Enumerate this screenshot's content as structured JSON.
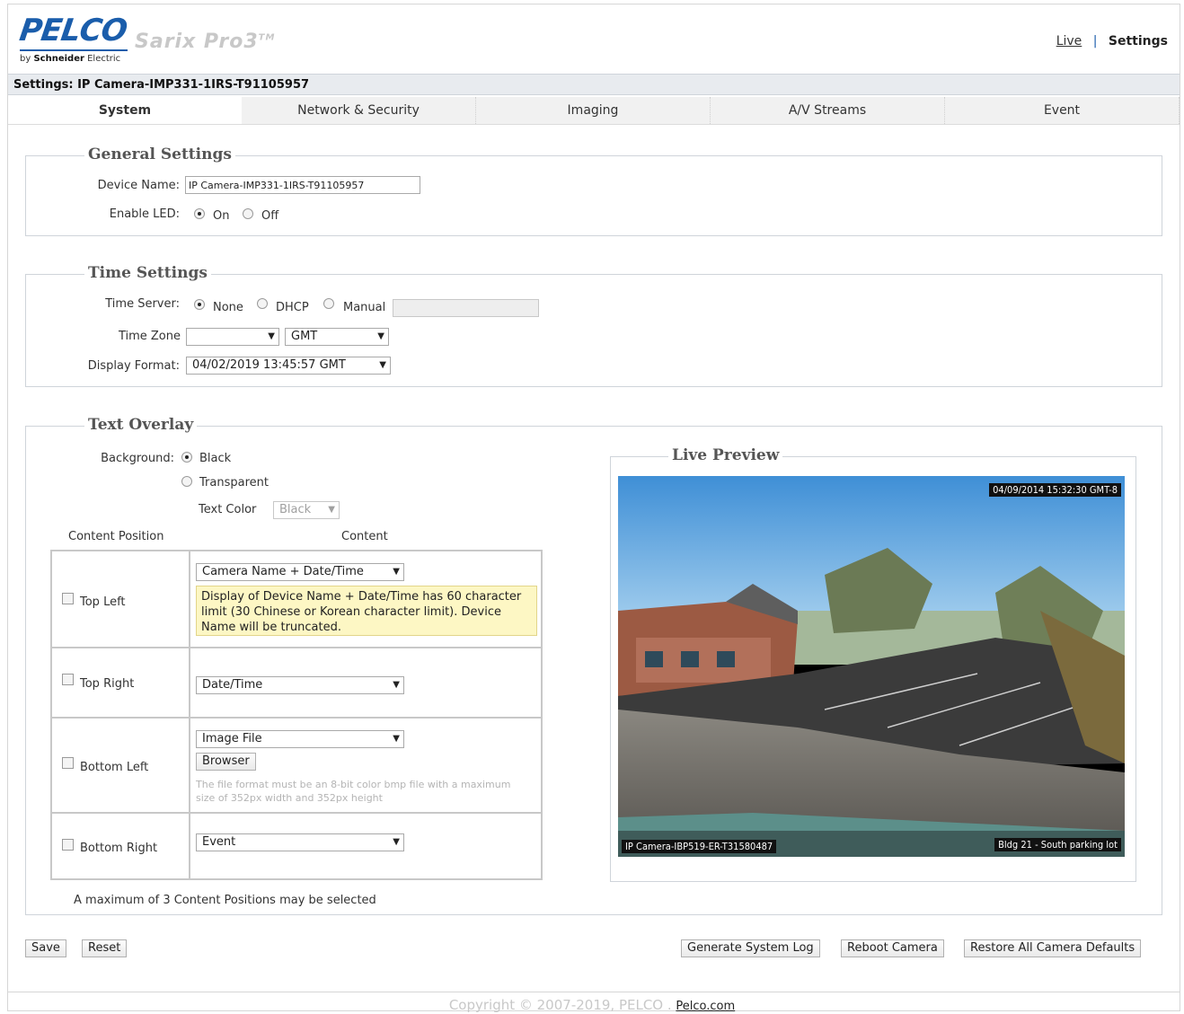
{
  "header": {
    "logo": "PELCO",
    "logo_sub_prefix": "by",
    "logo_sub_brand": "Schneider",
    "logo_sub_suffix": "Electric",
    "product": "Sarix Pro3",
    "product_tm": "TM",
    "nav_live": "Live",
    "nav_separator": "|",
    "nav_settings": "Settings"
  },
  "title_bar": "Settings: IP Camera-IMP331-1IRS-T91105957",
  "tabs": [
    "System",
    "Network & Security",
    "Imaging",
    "A/V Streams",
    "Event"
  ],
  "general": {
    "legend": "General Settings",
    "device_name_label": "Device Name:",
    "device_name_value": "IP Camera-IMP331-1IRS-T91105957",
    "enable_led_label": "Enable LED:",
    "led_on": "On",
    "led_off": "Off"
  },
  "time": {
    "legend": "Time Settings",
    "server_label": "Time Server:",
    "server_none": "None",
    "server_dhcp": "DHCP",
    "server_manual": "Manual",
    "zone_label": "Time Zone",
    "zone_region": "",
    "zone_value": "GMT",
    "format_label": "Display Format:",
    "format_value": "04/02/2019 13:45:57 GMT"
  },
  "overlay": {
    "legend": "Text Overlay",
    "background_label": "Background:",
    "bg_black": "Black",
    "bg_transparent": "Transparent",
    "text_color_label": "Text Color",
    "text_color_value": "Black",
    "col_position": "Content Position",
    "col_content": "Content",
    "rows": [
      {
        "position": "Top Left",
        "content": "Camera Name + Date/Time"
      },
      {
        "position": "Top Right",
        "content": "Date/Time"
      },
      {
        "position": "Bottom Left",
        "content": "Image File"
      },
      {
        "position": "Bottom Right",
        "content": "Event"
      }
    ],
    "note": "Display of Device Name + Date/Time has 60 character limit (30 Chinese or Korean character limit). Device Name will be truncated.",
    "browser_button": "Browser",
    "file_hint": "The file format must be an 8-bit color bmp file with a maximum size of 352px width and 352px height",
    "max_note": "A maximum of 3 Content Positions may be selected"
  },
  "preview": {
    "legend": "Live Preview",
    "timestamp": "04/09/2014 15:32:30 GMT-8",
    "camera_name": "IP Camera-IBP519-ER-T31580487",
    "location": "Bldg 21 - South parking lot"
  },
  "buttons": {
    "save": "Save",
    "reset": "Reset",
    "generate_log": "Generate System Log",
    "reboot": "Reboot Camera",
    "restore": "Restore All Camera Defaults"
  },
  "footer": {
    "copyright": "Copyright © 2007-2019, PELCO .",
    "link": "Pelco.com"
  }
}
